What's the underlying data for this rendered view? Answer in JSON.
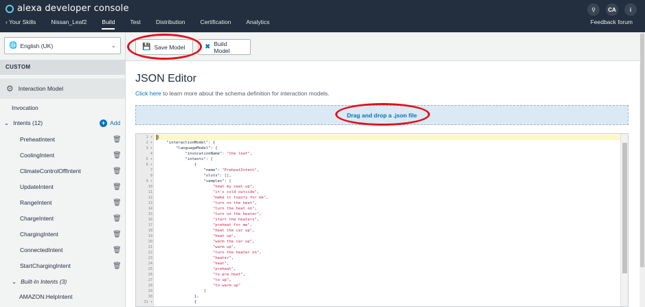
{
  "app": {
    "title": "alexa developer console"
  },
  "header": {
    "back_label": "Your Skills",
    "tabs": [
      {
        "label": "Nissan_Leaf2"
      },
      {
        "label": "Build"
      },
      {
        "label": "Test"
      },
      {
        "label": "Distribution"
      },
      {
        "label": "Certification"
      },
      {
        "label": "Analytics"
      }
    ],
    "active_tab": "Build",
    "feedback_label": "Feedback forum",
    "avatar_initials": "CA",
    "info_label": "i"
  },
  "sidebar": {
    "language": "English (UK)",
    "section_label": "CUSTOM",
    "interaction_model_label": "Interaction Model",
    "invocation_label": "Invocation",
    "intents_label": "Intents (12)",
    "add_label": "Add",
    "intents": [
      "PreheatIntent",
      "CoolingIntent",
      "ClimateControlOffIntent",
      "UpdateIntent",
      "RangeIntent",
      "ChargeIntent",
      "ChargingIntent",
      "ConnectedIntent",
      "StartChargingIntent"
    ],
    "builtin_label": "Built-In Intents (3)",
    "builtin_items": [
      "AMAZON.HelpIntent"
    ]
  },
  "toolbar": {
    "save_label": "Save Model",
    "build_label": "Build Model"
  },
  "main": {
    "title": "JSON Editor",
    "link_text": "Click here",
    "link_rest": " to learn more about the schema definition for interaction models.",
    "dropzone_label": "Drag and drop a .json file"
  },
  "editor": {
    "line_numbers": [
      "1",
      "2",
      "3",
      "4",
      "5",
      "6",
      "7",
      "8",
      "9",
      "10",
      "11",
      "12",
      "13",
      "14",
      "15",
      "16",
      "17",
      "18",
      "19",
      "20",
      "21",
      "22",
      "23",
      "24",
      "25",
      "26",
      "27",
      "28",
      "29",
      "30",
      "31"
    ],
    "fold_lines": [
      1,
      2,
      3,
      5,
      6,
      9,
      31
    ],
    "lines": [
      {
        "k": "{",
        "s": "",
        "e": ""
      },
      {
        "k": "    \"interactionModel\": {",
        "s": "",
        "e": ""
      },
      {
        "k": "        \"languageModel\": {",
        "s": "",
        "e": ""
      },
      {
        "k": "            \"invocationName\": ",
        "s": "\"the leaf\"",
        "e": ","
      },
      {
        "k": "            \"intents\": [",
        "s": "",
        "e": ""
      },
      {
        "k": "                {",
        "s": "",
        "e": ""
      },
      {
        "k": "                    \"name\": ",
        "s": "\"PreheatIntent\"",
        "e": ","
      },
      {
        "k": "                    \"slots\": [],",
        "s": "",
        "e": ""
      },
      {
        "k": "                    \"samples\": [",
        "s": "",
        "e": ""
      },
      {
        "k": "                        ",
        "s": "\"heat my seat up\"",
        "e": ","
      },
      {
        "k": "                        ",
        "s": "\"it's cold outside\"",
        "e": ","
      },
      {
        "k": "                        ",
        "s": "\"make it toasty for me\"",
        "e": ","
      },
      {
        "k": "                        ",
        "s": "\"turn on the heat\"",
        "e": ","
      },
      {
        "k": "                        ",
        "s": "\"turn the heat on\"",
        "e": ","
      },
      {
        "k": "                        ",
        "s": "\"turn on the heater\"",
        "e": ","
      },
      {
        "k": "                        ",
        "s": "\"start the heaters\"",
        "e": ","
      },
      {
        "k": "                        ",
        "s": "\"preheat for me\"",
        "e": ","
      },
      {
        "k": "                        ",
        "s": "\"heat the car up\"",
        "e": ","
      },
      {
        "k": "                        ",
        "s": "\"heat up\"",
        "e": ","
      },
      {
        "k": "                        ",
        "s": "\"warm the car up\"",
        "e": ","
      },
      {
        "k": "                        ",
        "s": "\"warm up\"",
        "e": ","
      },
      {
        "k": "                        ",
        "s": "\"turn the heater on\"",
        "e": ","
      },
      {
        "k": "                        ",
        "s": "\"heater\"",
        "e": ","
      },
      {
        "k": "                        ",
        "s": "\"heat\"",
        "e": ","
      },
      {
        "k": "                        ",
        "s": "\"preheat\"",
        "e": ","
      },
      {
        "k": "                        ",
        "s": "\"to pre heat\"",
        "e": ","
      },
      {
        "k": "                        ",
        "s": "\"to up\"",
        "e": ","
      },
      {
        "k": "                        ",
        "s": "\"to warm up\"",
        "e": ""
      },
      {
        "k": "                    ]",
        "s": "",
        "e": ""
      },
      {
        "k": "                },",
        "s": "",
        "e": ""
      },
      {
        "k": "                {",
        "s": "",
        "e": ""
      }
    ]
  },
  "colors": {
    "header_bg": "#232f3e",
    "accent": "#0073bb",
    "highlight_ring": "#e3101b",
    "string": "#c7254e"
  }
}
